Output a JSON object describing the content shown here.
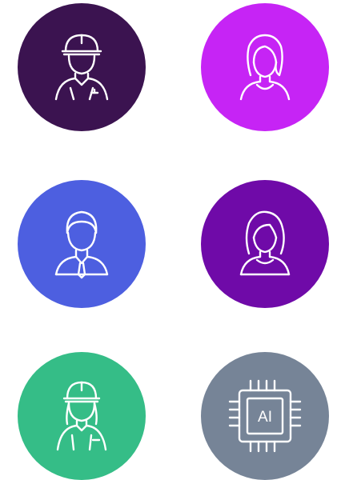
{
  "avatars": [
    {
      "icon": "construction-worker-icon",
      "color": "#3b1350"
    },
    {
      "icon": "woman-icon",
      "color": "#c624f5"
    },
    {
      "icon": "businessman-icon",
      "color": "#4d5fe0"
    },
    {
      "icon": "woman-icon",
      "color": "#6f0aa8"
    },
    {
      "icon": "female-construction-worker-icon",
      "color": "#35bd87"
    },
    {
      "icon": "ai-chip-icon",
      "color": "#768497"
    }
  ],
  "ai_chip": {
    "label": "AI"
  }
}
